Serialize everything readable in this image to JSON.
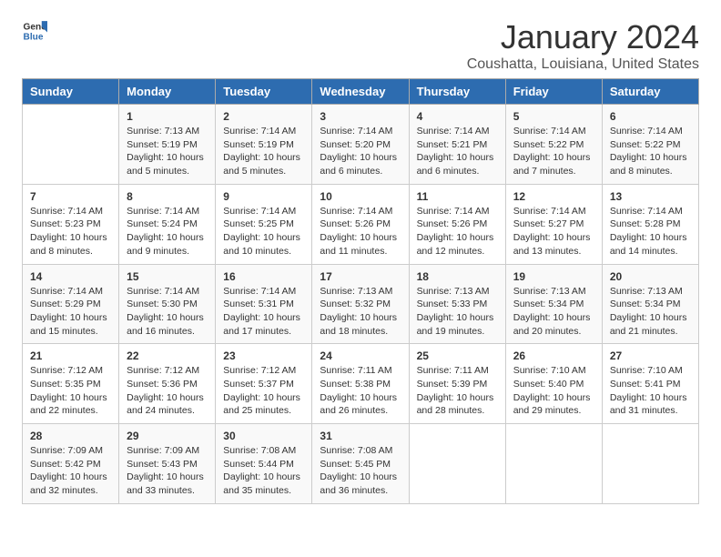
{
  "logo": {
    "text_general": "General",
    "text_blue": "Blue"
  },
  "title": "January 2024",
  "subtitle": "Coushatta, Louisiana, United States",
  "days_of_week": [
    "Sunday",
    "Monday",
    "Tuesday",
    "Wednesday",
    "Thursday",
    "Friday",
    "Saturday"
  ],
  "weeks": [
    [
      {
        "day": "",
        "info": ""
      },
      {
        "day": "1",
        "info": "Sunrise: 7:13 AM\nSunset: 5:19 PM\nDaylight: 10 hours\nand 5 minutes."
      },
      {
        "day": "2",
        "info": "Sunrise: 7:14 AM\nSunset: 5:19 PM\nDaylight: 10 hours\nand 5 minutes."
      },
      {
        "day": "3",
        "info": "Sunrise: 7:14 AM\nSunset: 5:20 PM\nDaylight: 10 hours\nand 6 minutes."
      },
      {
        "day": "4",
        "info": "Sunrise: 7:14 AM\nSunset: 5:21 PM\nDaylight: 10 hours\nand 6 minutes."
      },
      {
        "day": "5",
        "info": "Sunrise: 7:14 AM\nSunset: 5:22 PM\nDaylight: 10 hours\nand 7 minutes."
      },
      {
        "day": "6",
        "info": "Sunrise: 7:14 AM\nSunset: 5:22 PM\nDaylight: 10 hours\nand 8 minutes."
      }
    ],
    [
      {
        "day": "7",
        "info": "Sunrise: 7:14 AM\nSunset: 5:23 PM\nDaylight: 10 hours\nand 8 minutes."
      },
      {
        "day": "8",
        "info": "Sunrise: 7:14 AM\nSunset: 5:24 PM\nDaylight: 10 hours\nand 9 minutes."
      },
      {
        "day": "9",
        "info": "Sunrise: 7:14 AM\nSunset: 5:25 PM\nDaylight: 10 hours\nand 10 minutes."
      },
      {
        "day": "10",
        "info": "Sunrise: 7:14 AM\nSunset: 5:26 PM\nDaylight: 10 hours\nand 11 minutes."
      },
      {
        "day": "11",
        "info": "Sunrise: 7:14 AM\nSunset: 5:26 PM\nDaylight: 10 hours\nand 12 minutes."
      },
      {
        "day": "12",
        "info": "Sunrise: 7:14 AM\nSunset: 5:27 PM\nDaylight: 10 hours\nand 13 minutes."
      },
      {
        "day": "13",
        "info": "Sunrise: 7:14 AM\nSunset: 5:28 PM\nDaylight: 10 hours\nand 14 minutes."
      }
    ],
    [
      {
        "day": "14",
        "info": "Sunrise: 7:14 AM\nSunset: 5:29 PM\nDaylight: 10 hours\nand 15 minutes."
      },
      {
        "day": "15",
        "info": "Sunrise: 7:14 AM\nSunset: 5:30 PM\nDaylight: 10 hours\nand 16 minutes."
      },
      {
        "day": "16",
        "info": "Sunrise: 7:14 AM\nSunset: 5:31 PM\nDaylight: 10 hours\nand 17 minutes."
      },
      {
        "day": "17",
        "info": "Sunrise: 7:13 AM\nSunset: 5:32 PM\nDaylight: 10 hours\nand 18 minutes."
      },
      {
        "day": "18",
        "info": "Sunrise: 7:13 AM\nSunset: 5:33 PM\nDaylight: 10 hours\nand 19 minutes."
      },
      {
        "day": "19",
        "info": "Sunrise: 7:13 AM\nSunset: 5:34 PM\nDaylight: 10 hours\nand 20 minutes."
      },
      {
        "day": "20",
        "info": "Sunrise: 7:13 AM\nSunset: 5:34 PM\nDaylight: 10 hours\nand 21 minutes."
      }
    ],
    [
      {
        "day": "21",
        "info": "Sunrise: 7:12 AM\nSunset: 5:35 PM\nDaylight: 10 hours\nand 22 minutes."
      },
      {
        "day": "22",
        "info": "Sunrise: 7:12 AM\nSunset: 5:36 PM\nDaylight: 10 hours\nand 24 minutes."
      },
      {
        "day": "23",
        "info": "Sunrise: 7:12 AM\nSunset: 5:37 PM\nDaylight: 10 hours\nand 25 minutes."
      },
      {
        "day": "24",
        "info": "Sunrise: 7:11 AM\nSunset: 5:38 PM\nDaylight: 10 hours\nand 26 minutes."
      },
      {
        "day": "25",
        "info": "Sunrise: 7:11 AM\nSunset: 5:39 PM\nDaylight: 10 hours\nand 28 minutes."
      },
      {
        "day": "26",
        "info": "Sunrise: 7:10 AM\nSunset: 5:40 PM\nDaylight: 10 hours\nand 29 minutes."
      },
      {
        "day": "27",
        "info": "Sunrise: 7:10 AM\nSunset: 5:41 PM\nDaylight: 10 hours\nand 31 minutes."
      }
    ],
    [
      {
        "day": "28",
        "info": "Sunrise: 7:09 AM\nSunset: 5:42 PM\nDaylight: 10 hours\nand 32 minutes."
      },
      {
        "day": "29",
        "info": "Sunrise: 7:09 AM\nSunset: 5:43 PM\nDaylight: 10 hours\nand 33 minutes."
      },
      {
        "day": "30",
        "info": "Sunrise: 7:08 AM\nSunset: 5:44 PM\nDaylight: 10 hours\nand 35 minutes."
      },
      {
        "day": "31",
        "info": "Sunrise: 7:08 AM\nSunset: 5:45 PM\nDaylight: 10 hours\nand 36 minutes."
      },
      {
        "day": "",
        "info": ""
      },
      {
        "day": "",
        "info": ""
      },
      {
        "day": "",
        "info": ""
      }
    ]
  ]
}
